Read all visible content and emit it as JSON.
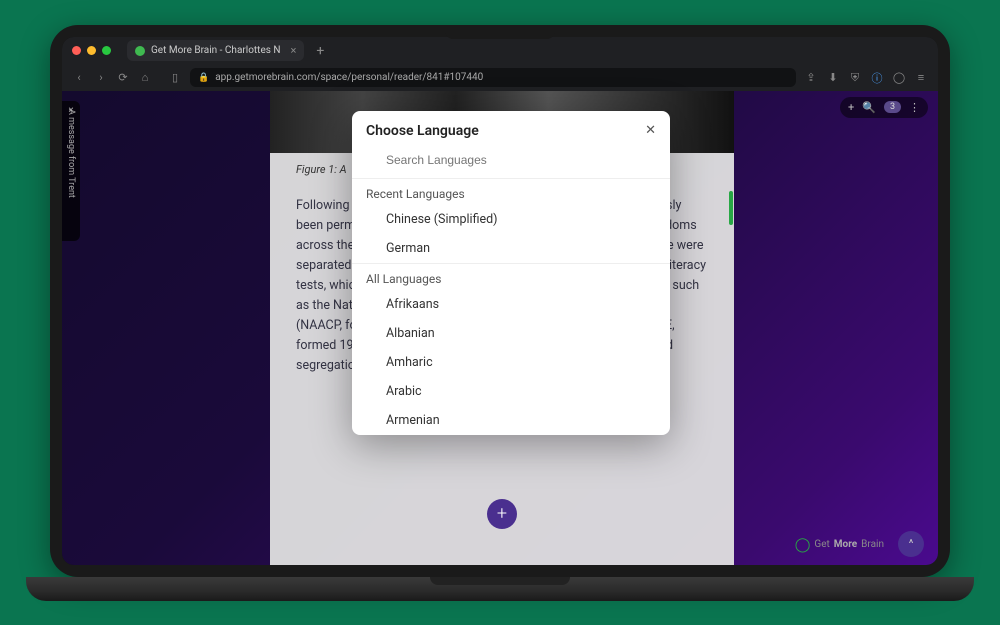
{
  "browser": {
    "tab_title": "Get More Brain - Charlottes N",
    "url": "app.getmorebrain.com/space/personal/reader/841#107440"
  },
  "side_panel": {
    "label": "A message from Trent"
  },
  "toolbar": {
    "badge": "3"
  },
  "reader": {
    "figure_caption": "Figure 1: A",
    "article_text": "Following the abolition of slavery in 1865, black people had previously been permitted. Now black Americans were many of the same freedoms across the South began – which enforced racial segregation. People were separated in schools, restaurants, to disenfranchise black people's literacy tests, which in the first half of the twentieth century organizations – such as the National Association for the Advancement of Colored People (NAACP, formed in 1909) and the Congress of Racial Equality (CORE, formed 1942) – to advance their rights, but racial discrimination and segregation were still firmly in place by the 1950s."
  },
  "modal": {
    "title": "Choose Language",
    "search_placeholder": "Search Languages",
    "recent_label": "Recent Languages",
    "recent": [
      "Chinese (Simplified)",
      "German"
    ],
    "all_label": "All Languages",
    "all": [
      "Afrikaans",
      "Albanian",
      "Amharic",
      "Arabic",
      "Armenian"
    ]
  },
  "footer": {
    "brand_pre": "Get",
    "brand_mid": "More",
    "brand_post": "Brain"
  }
}
